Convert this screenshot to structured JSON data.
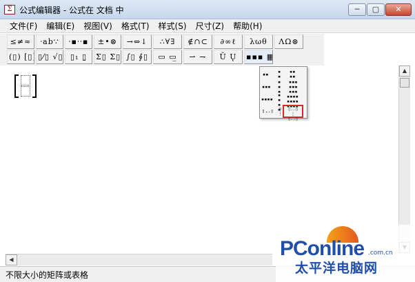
{
  "window": {
    "app_icon": "Σ",
    "title": "公式编辑器 - 公式在 文档 中",
    "minimize_glyph": "─",
    "maximize_glyph": "▢",
    "close_glyph": "✕"
  },
  "menu": [
    "文件(F)",
    "编辑(E)",
    "视图(V)",
    "格式(T)",
    "样式(S)",
    "尺寸(Z)",
    "帮助(H)"
  ],
  "toolbar": {
    "row1": [
      "≤≠≈",
      "⸱ab∵",
      "⸱▪⸱⸱▪",
      "±•⊗",
      "→⇔↓",
      "∴∀∃",
      "∉∩⊂",
      "∂∞ℓ",
      "λωθ",
      "ΛΩ⊛"
    ],
    "row2": [
      "(▯) [▯]",
      "▯⁄▯ √▯",
      "▯₁ ▯̤",
      "Σ▯ Σ▯",
      "∫▯ ∮▯",
      "▭ ▭̲",
      "⇀ ⇁",
      "Ū Ų",
      "▪▪▪ ▦"
    ]
  },
  "palette": {
    "items": [
      "▪▪",
      "▪\n▪",
      "▪▪\n▪▪",
      "▪▪▪",
      "▪\n▪\n▪",
      "▪▪▪\n▪▪▪\n▪▪▪",
      "▪▪▪▪",
      "▪\n▪\n▪\n▪",
      "▪▪▪▪\n▪▪▪▪\n▪▪▪▪",
      "▯..▯",
      "▯\n⋮"
    ],
    "highlighted": "▯..▯\n ⋮ \n▯..▯"
  },
  "scroll": {
    "up": "▲",
    "down": "▼",
    "left": "◀"
  },
  "status": "不限大小的矩阵或表格",
  "watermark": {
    "brand": "PConline",
    "domain": ".com.cn",
    "chinese": "太平洋电脑网"
  }
}
